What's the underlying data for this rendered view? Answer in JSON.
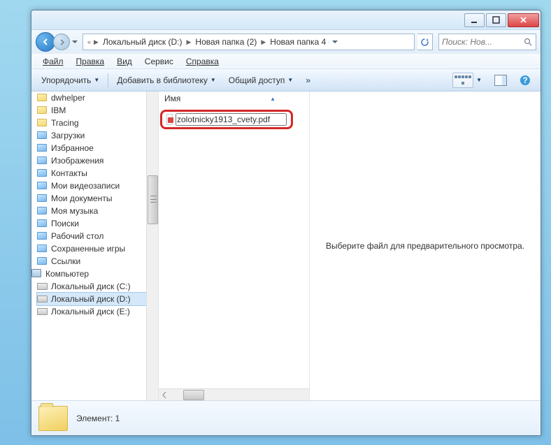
{
  "path": {
    "prefix": "«",
    "crumbs": [
      "Локальный диск (D:)",
      "Новая папка (2)",
      "Новая папка 4"
    ]
  },
  "search": {
    "placeholder": "Поиск: Нов..."
  },
  "menu": {
    "file": "Файл",
    "edit": "Правка",
    "view": "Вид",
    "tools": "Сервис",
    "help": "Справка"
  },
  "toolbar": {
    "organize": "Упорядочить",
    "library": "Добавить в библиотеку",
    "share": "Общий доступ",
    "more": "»"
  },
  "tree": [
    {
      "label": "dwhelper",
      "type": "folder"
    },
    {
      "label": "IBM",
      "type": "folder"
    },
    {
      "label": "Tracing",
      "type": "folder"
    },
    {
      "label": "Загрузки",
      "type": "folder-sp"
    },
    {
      "label": "Избранное",
      "type": "folder-sp"
    },
    {
      "label": "Изображения",
      "type": "folder-sp"
    },
    {
      "label": "Контакты",
      "type": "folder-sp"
    },
    {
      "label": "Мои видеозаписи",
      "type": "folder-sp"
    },
    {
      "label": "Мои документы",
      "type": "folder-sp"
    },
    {
      "label": "Моя музыка",
      "type": "folder-sp"
    },
    {
      "label": "Поиски",
      "type": "folder-sp"
    },
    {
      "label": "Рабочий стол",
      "type": "folder-sp"
    },
    {
      "label": "Сохраненные игры",
      "type": "folder-sp"
    },
    {
      "label": "Ссылки",
      "type": "folder-sp"
    },
    {
      "label": "Компьютер",
      "type": "computer",
      "indent": -1
    },
    {
      "label": "Локальный диск (C:)",
      "type": "drive"
    },
    {
      "label": "Локальный диск (D:)",
      "type": "drive",
      "sel": true
    },
    {
      "label": "Локальный диск (E:)",
      "type": "drive"
    }
  ],
  "columns": {
    "name": "Имя"
  },
  "file": {
    "name": "zolotnicky1913_cvety.pdf"
  },
  "preview": {
    "hint": "Выберите файл для предварительного просмотра."
  },
  "status": {
    "count": "Элемент: 1"
  }
}
